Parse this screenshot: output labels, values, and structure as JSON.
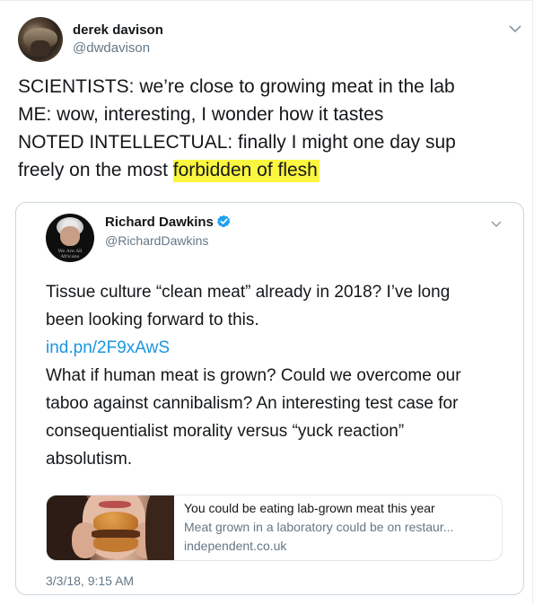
{
  "tweet": {
    "author_name": "derek davison",
    "author_handle": "@dwdavison",
    "text_lines": [
      "SCIENTISTS: we’re close to growing meat in the lab",
      "ME: wow, interesting, I wonder how it tastes",
      "NOTED INTELLECTUAL: finally I might one day sup"
    ],
    "last_line_prefix": "freely on the most ",
    "highlighted_text": "forbidden of flesh",
    "highlight_color": "#fbf63f"
  },
  "quoted_tweet": {
    "author_name": "Richard Dawkins",
    "author_handle": "@RichardDawkins",
    "avatar_shirt_text": "We Are All Africans",
    "text_lines_1": [
      "Tissue culture “clean meat” already in 2018? I’ve long",
      "been looking forward to this."
    ],
    "link": "ind.pn/2F9xAwS",
    "text_lines_2": [
      "What if human meat is grown? Could we overcome our",
      "taboo against cannibalism? An interesting test case for",
      "consequentialist morality versus “yuck reaction”",
      "absolutism."
    ],
    "link_card": {
      "title": "You could be eating lab-grown meat this year",
      "description": "Meat grown in a laboratory could be on restaur...",
      "domain": "independent.co.uk"
    },
    "timestamp": "3/3/18, 9:15 AM"
  },
  "icons": {
    "menu": "chevron-down-icon",
    "verified": "verified-badge-icon"
  },
  "colors": {
    "link": "#1b95e0",
    "secondary_text": "#657786",
    "verified": "#1da1f2"
  }
}
